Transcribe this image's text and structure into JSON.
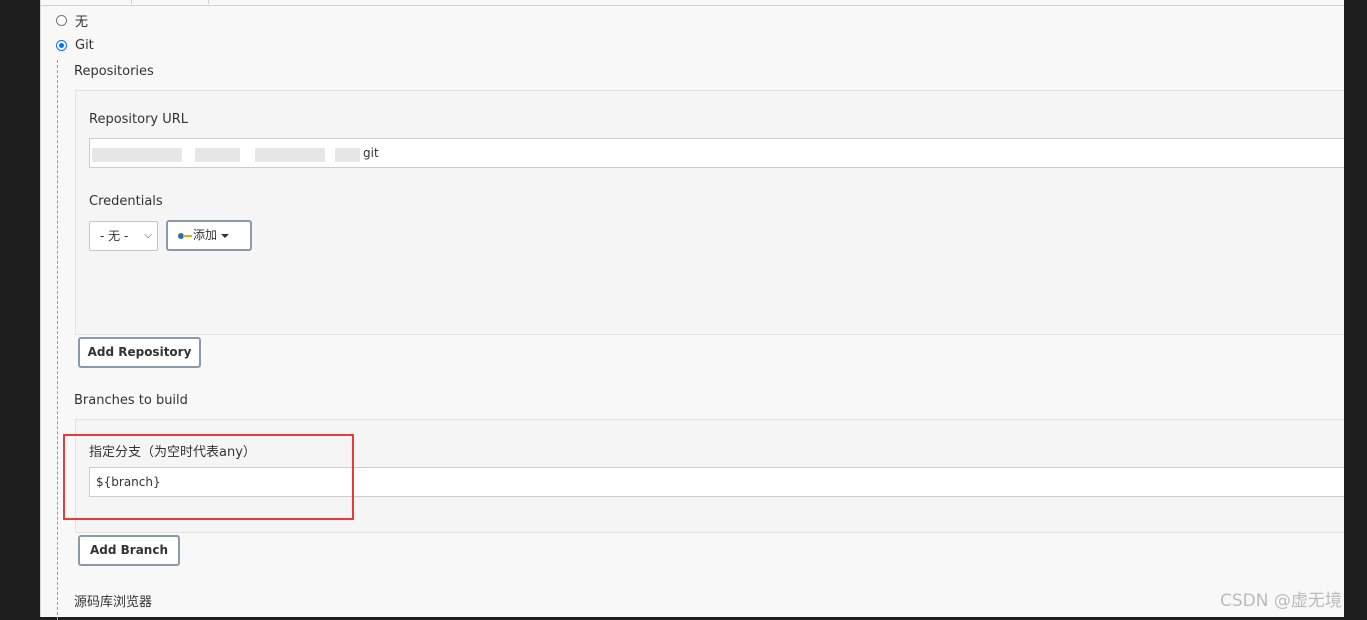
{
  "scm": {
    "options": [
      {
        "label": "无",
        "checked": false
      },
      {
        "label": "Git",
        "checked": true
      }
    ]
  },
  "repositories": {
    "section_label": "Repositories",
    "url_label": "Repository URL",
    "url_value_visible_suffix": "git",
    "credentials_label": "Credentials",
    "credentials_select": "- 无 -",
    "add_credentials_label": "添加",
    "add_repository_label": "Add Repository"
  },
  "branches": {
    "section_label": "Branches to build",
    "specifier_label": "指定分支（为空时代表any）",
    "specifier_value": "${branch}",
    "add_branch_label": "Add Branch"
  },
  "browser": {
    "section_label": "源码库浏览器"
  },
  "watermark": "CSDN @虚无境",
  "colors": {
    "accent": "#0075ff",
    "highlight": "#e83a3a",
    "button_border": "#8a9aa9"
  }
}
